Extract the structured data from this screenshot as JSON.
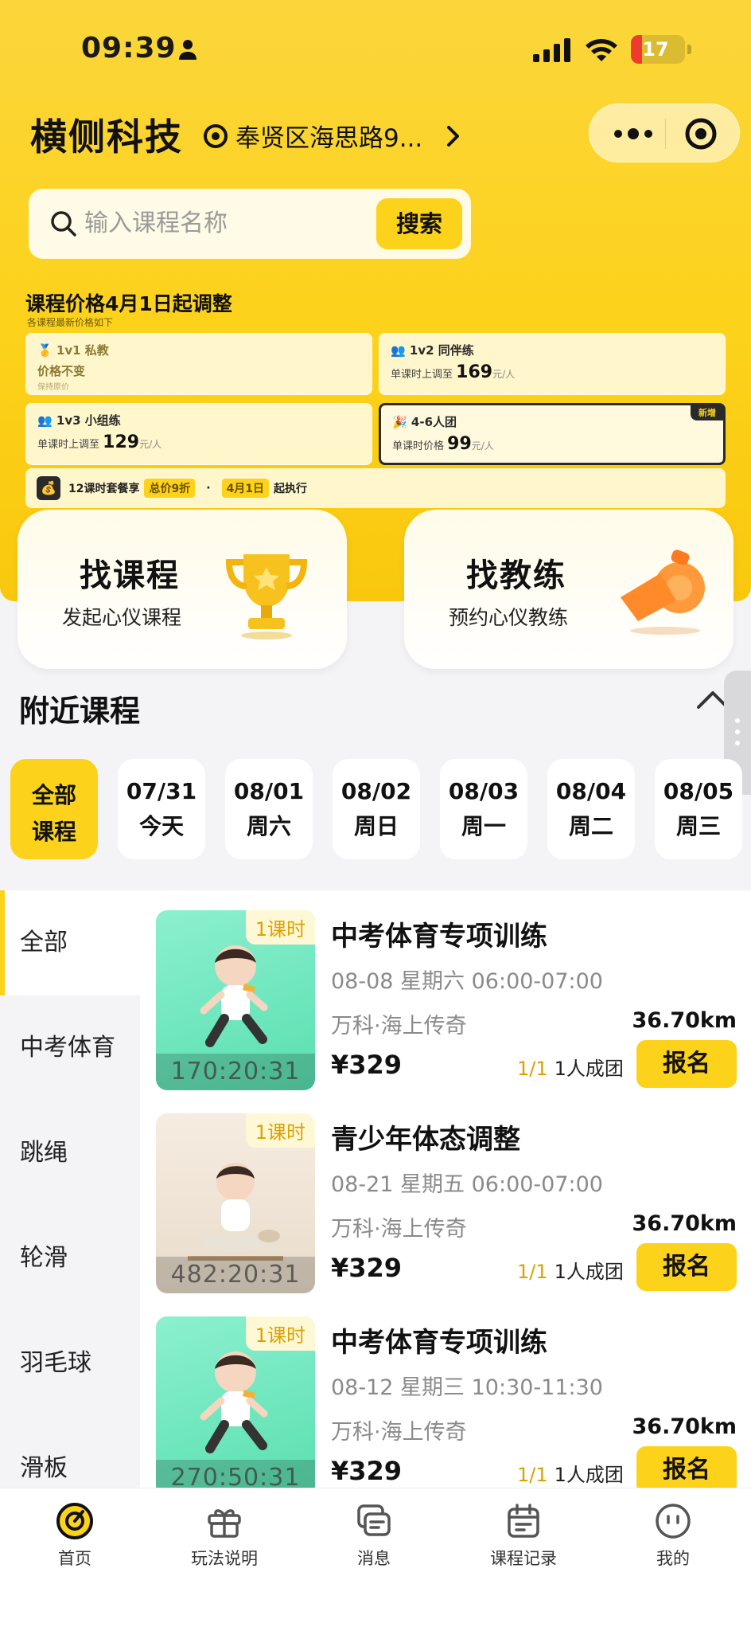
{
  "status": {
    "time": "09:39",
    "battery": "17"
  },
  "nav": {
    "brand": "横侧科技",
    "location": "奉贤区海思路9..."
  },
  "search": {
    "placeholder": "输入课程名称",
    "button": "搜索"
  },
  "notice": {
    "title": "课程价格4月1日起调整",
    "subtitle": "各课程最新价格如下",
    "cards": [
      {
        "icon": "🥇",
        "name": "1v1 私教",
        "line": "价格不变",
        "note": "保持原价"
      },
      {
        "icon": "👥",
        "name": "1v2 同伴练",
        "prefix": "单课时上调至",
        "price": "169",
        "unit": "元/人"
      },
      {
        "icon": "👥",
        "name": "1v3 小组练",
        "prefix": "单课时上调至",
        "price": "129",
        "unit": "元/人"
      },
      {
        "icon": "🎉",
        "name": "4-6人团",
        "prefix": "单课时价格",
        "price": "99",
        "unit": "元/人",
        "badge": "新增"
      }
    ],
    "pack": {
      "icon": "💰",
      "text1": "12课时套餐享",
      "tag1": "总价9折",
      "dot": "·",
      "tag2": "4月1日",
      "text2": "起执行"
    }
  },
  "entries": [
    {
      "title": "找课程",
      "subtitle": "发起心仪课程"
    },
    {
      "title": "找教练",
      "subtitle": "预约心仪教练"
    }
  ],
  "nearby": {
    "title": "附近课程"
  },
  "dates": [
    {
      "a": "全部",
      "b": "课程"
    },
    {
      "a": "07/31",
      "b": "今天"
    },
    {
      "a": "08/01",
      "b": "周六"
    },
    {
      "a": "08/02",
      "b": "周日"
    },
    {
      "a": "08/03",
      "b": "周一"
    },
    {
      "a": "08/04",
      "b": "周二"
    },
    {
      "a": "08/05",
      "b": "周三"
    }
  ],
  "categories": [
    "全部",
    "中考体育",
    "跳绳",
    "轮滑",
    "羽毛球",
    "滑板"
  ],
  "courses": [
    {
      "tag": "1课时",
      "countdown": "170:20:31",
      "title": "中考体育专项训练",
      "when": "08-08 星期六 06:00-07:00",
      "venue": "万科·海上传奇",
      "price": "¥329",
      "distance": "36.70km",
      "ratio": "1/1",
      "group": "1人成团",
      "button": "报名"
    },
    {
      "tag": "1课时",
      "countdown": "482:20:31",
      "title": "青少年体态调整",
      "when": "08-21 星期五 06:00-07:00",
      "venue": "万科·海上传奇",
      "price": "¥329",
      "distance": "36.70km",
      "ratio": "1/1",
      "group": "1人成团",
      "button": "报名"
    },
    {
      "tag": "1课时",
      "countdown": "270:50:31",
      "title": "中考体育专项训练",
      "when": "08-12 星期三 10:30-11:30",
      "venue": "万科·海上传奇",
      "price": "¥329",
      "distance": "36.70km",
      "ratio": "1/1",
      "group": "1人成团",
      "button": "报名"
    }
  ],
  "tabs": [
    "首页",
    "玩法说明",
    "消息",
    "课程记录",
    "我的"
  ],
  "colors": {
    "accent": "#fcd21a",
    "gold": "#d9a200"
  }
}
